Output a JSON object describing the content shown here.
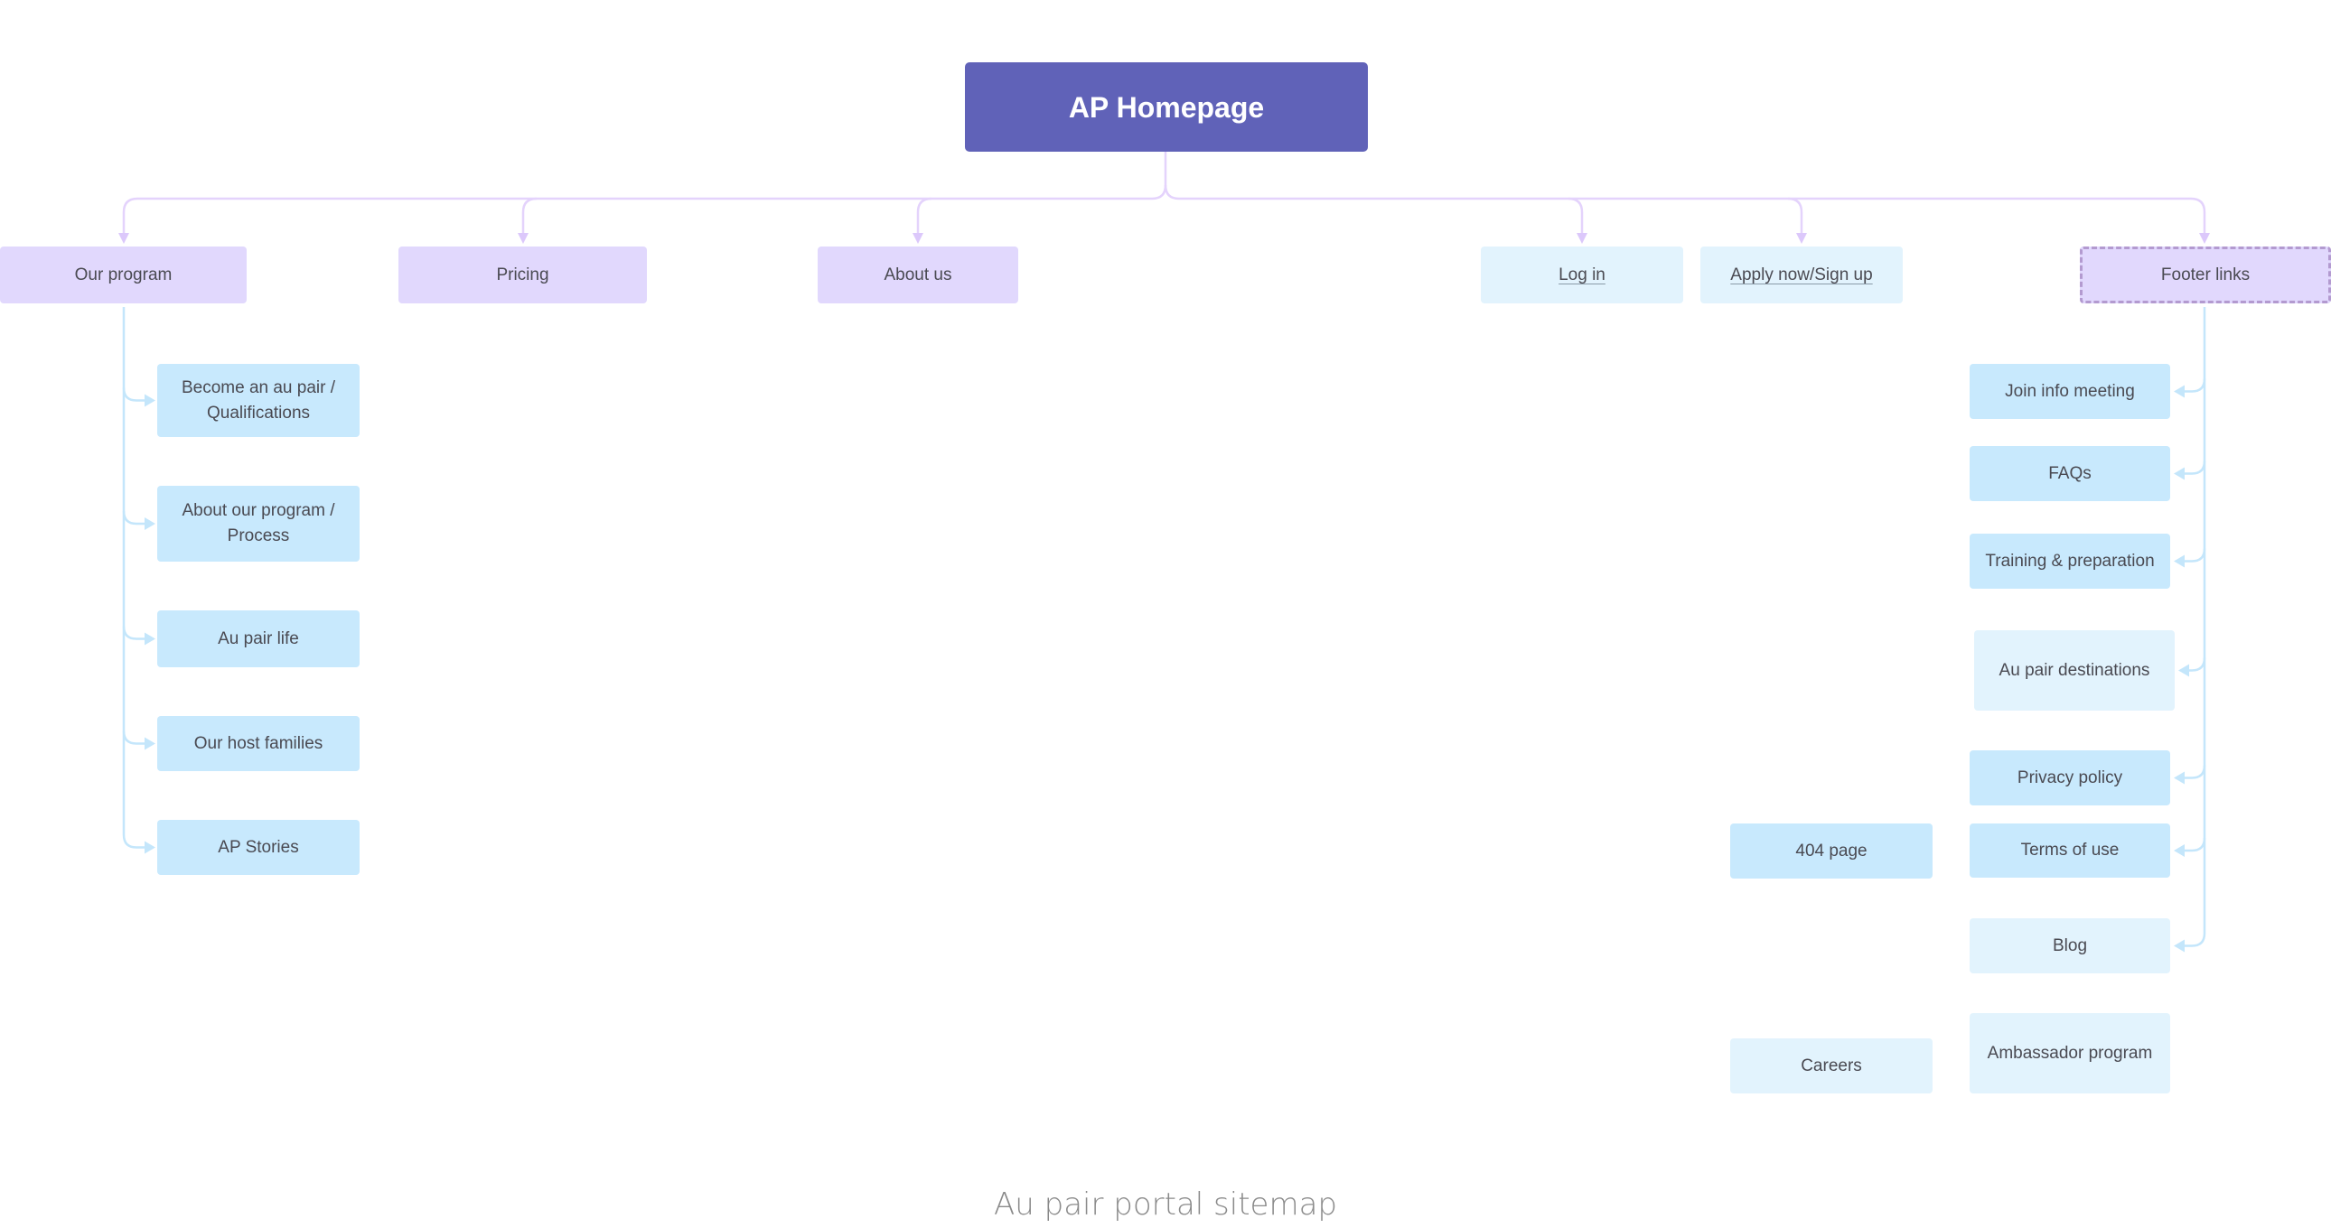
{
  "diagram": {
    "title": "Au pair portal sitemap",
    "colors": {
      "root": "#6062b8",
      "top_level": "#e1d8fd",
      "child": "#c8e9fd",
      "child_pale": "#e2f3fd",
      "connector_purple": "#dcc8fb",
      "connector_blue": "#c4e6fb",
      "dashed_border": "#b39ad0"
    },
    "root": {
      "label": "AP Homepage"
    },
    "top_level": [
      {
        "id": "our-program",
        "label": "Our program"
      },
      {
        "id": "pricing",
        "label": "Pricing"
      },
      {
        "id": "about-us",
        "label": "About us"
      },
      {
        "id": "log-in",
        "label": "Log in",
        "underlined": true
      },
      {
        "id": "apply",
        "label": "Apply now/Sign up",
        "underlined": true
      },
      {
        "id": "footer-links",
        "label": "Footer links",
        "dashed": true
      }
    ],
    "our_program_children": [
      {
        "label": "Become an au pair / Qualifications"
      },
      {
        "label": "About our program / Process"
      },
      {
        "label": "Au pair life"
      },
      {
        "label": "Our host families"
      },
      {
        "label": "AP Stories"
      }
    ],
    "footer_children": [
      {
        "label": "Join info meeting"
      },
      {
        "label": "FAQs"
      },
      {
        "label": "Training & preparation"
      },
      {
        "label": "Au pair destinations"
      },
      {
        "label": "Privacy policy"
      },
      {
        "label": "Terms of use"
      },
      {
        "label": "Blog"
      },
      {
        "label": "Ambassador program"
      }
    ],
    "unlinked_pages": [
      {
        "label": "404 page"
      },
      {
        "label": "Careers"
      }
    ]
  }
}
